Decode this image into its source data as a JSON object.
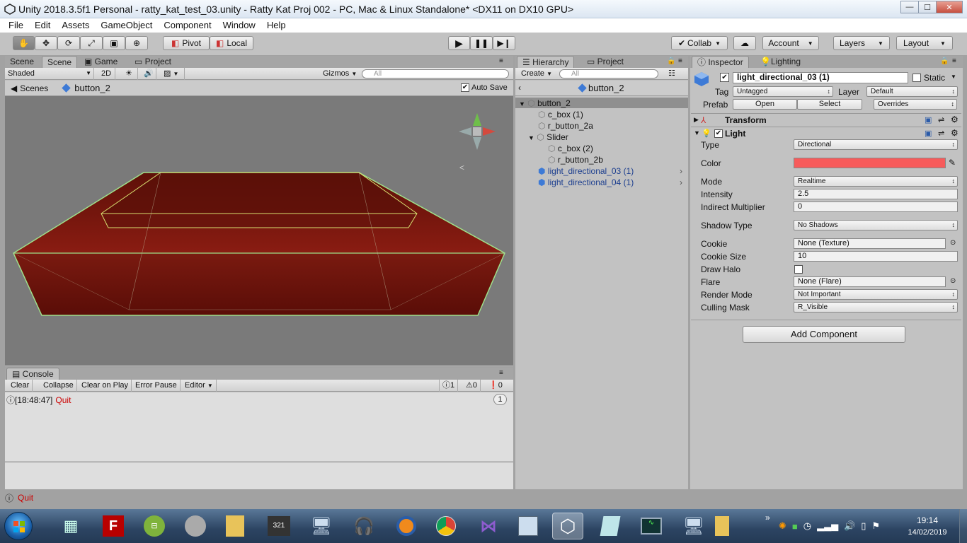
{
  "window": {
    "title": "Unity 2018.3.5f1 Personal - ratty_kat_test_03.unity - Ratty Kat Proj 002 - PC, Mac & Linux Standalone* <DX11 on DX10 GPU>",
    "min": "—",
    "max": "☐",
    "close": "✕"
  },
  "menu": [
    "File",
    "Edit",
    "Assets",
    "GameObject",
    "Component",
    "Window",
    "Help"
  ],
  "toolbar": {
    "pivot": "Pivot",
    "local": "Local",
    "collab": "Collab",
    "account": "Account",
    "layers": "Layers",
    "layout": "Layout"
  },
  "scene": {
    "tabs": [
      "Scene",
      "Scene",
      "Game",
      "Project"
    ],
    "shaded": "Shaded",
    "btn2d": "2D",
    "gizmos": "Gizmos",
    "search_placeholder": "All",
    "breadcrumb_root": "Scenes",
    "breadcrumb_item": "button_2",
    "autosave": "Auto Save"
  },
  "console": {
    "tab": "Console",
    "buttons": [
      "Clear",
      "Collapse",
      "Clear on Play",
      "Error Pause",
      "Editor"
    ],
    "counts": [
      "1",
      "0",
      "0"
    ],
    "log_time": "[18:48:47]",
    "log_msg": "Quit",
    "log_count": "1",
    "status": "Quit"
  },
  "hierarchy": {
    "tabs": [
      "Hierarchy",
      "Project"
    ],
    "create": "Create",
    "search_placeholder": "All",
    "header": "button_2",
    "items": [
      {
        "label": "button_2",
        "depth": 0
      },
      {
        "label": "c_box (1)",
        "depth": 1
      },
      {
        "label": "r_button_2a",
        "depth": 1
      },
      {
        "label": "Slider",
        "depth": 1
      },
      {
        "label": "c_box (2)",
        "depth": 2
      },
      {
        "label": "r_button_2b",
        "depth": 2
      },
      {
        "label": "light_directional_03 (1)",
        "depth": 1
      },
      {
        "label": "light_directional_04 (1)",
        "depth": 1
      }
    ]
  },
  "inspector": {
    "tabs": [
      "Inspector",
      "Lighting"
    ],
    "name": "light_directional_03 (1)",
    "static": "Static",
    "tag_label": "Tag",
    "tag": "Untagged",
    "layer_label": "Layer",
    "layer": "Default",
    "prefab_label": "Prefab",
    "open": "Open",
    "select": "Select",
    "overrides": "Overrides",
    "transform": "Transform",
    "light": "Light",
    "props": [
      {
        "label": "Type",
        "value": "Directional"
      },
      {
        "label": "Color",
        "value": ""
      },
      {
        "label": "Mode",
        "value": "Realtime"
      },
      {
        "label": "Intensity",
        "value": "2.5"
      },
      {
        "label": "Indirect Multiplier",
        "value": "0"
      },
      {
        "label": "Shadow Type",
        "value": "No Shadows"
      },
      {
        "label": "Cookie",
        "value": "None (Texture)"
      },
      {
        "label": "Cookie Size",
        "value": "10"
      },
      {
        "label": "Draw Halo",
        "value": ""
      },
      {
        "label": "Flare",
        "value": "None (Flare)"
      },
      {
        "label": "Render Mode",
        "value": "Not Important"
      },
      {
        "label": "Culling Mask",
        "value": "R_Visible"
      }
    ],
    "add_component": "Add Component",
    "light_color": "#f75b5b"
  },
  "taskbar": {
    "time": "19:14",
    "date": "14/02/2019",
    "chevron": "»"
  }
}
